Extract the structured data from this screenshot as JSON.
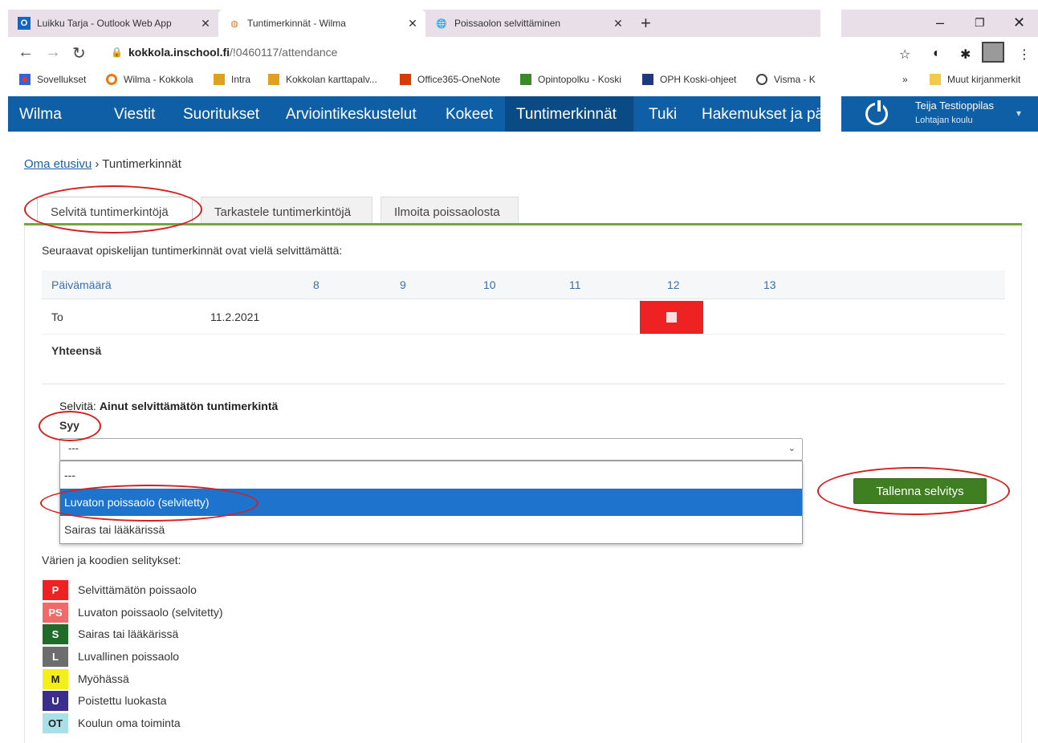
{
  "browser": {
    "tabs": [
      {
        "label": "Luikku Tarja - Outlook Web App",
        "icon": "O"
      },
      {
        "label": "Tuntimerkinnät - Wilma",
        "icon": "W"
      },
      {
        "label": "Poissaolon selvittäminen",
        "icon": "G"
      }
    ],
    "url_host": "kokkola.inschool.fi",
    "url_path": "/!0460117/attendance",
    "bookmarks": [
      "Sovellukset",
      "Wilma - Kokkola",
      "Intra",
      "Kokkolan karttapalv...",
      "Office365-OneNote",
      "Opintopolku - Koski",
      "OPH Koski-ohjeet",
      "Visma - K",
      "Muut kirjanmerkit"
    ]
  },
  "nav": {
    "logo": "Wilma",
    "items": [
      "Viestit",
      "Suoritukset",
      "Arviointikeskustelut",
      "Kokeet",
      "Tuntimerkinnät",
      "Tuki",
      "Hakemukset ja pä"
    ],
    "active_index": 4,
    "user_name": "Teija Testioppilas",
    "user_school": "Lohtajan koulu"
  },
  "breadcrumb": {
    "home": "Oma etusivu",
    "separator": "›",
    "current": "Tuntimerkinnät"
  },
  "tabs": [
    "Selvitä tuntimerkintöjä",
    "Tarkastele tuntimerkintöjä",
    "Ilmoita poissaolosta"
  ],
  "intro": "Seuraavat opiskelijan tuntimerkinnät ovat vielä selvittämättä:",
  "table": {
    "header": {
      "date_label": "Päivämäärä",
      "hours": [
        "8",
        "9",
        "10",
        "11",
        "12",
        "13"
      ]
    },
    "row": {
      "weekday": "To",
      "date": "11.2.2021"
    },
    "total_label": "Yhteensä"
  },
  "resolve": {
    "label": "Selvitä:",
    "text": "Ainut selvittämätön tuntimerkintä",
    "reason_label": "Syy",
    "select_value": "---",
    "options": [
      "---",
      "Luvaton poissaolo (selvitetty)",
      "Sairas tai lääkärissä"
    ],
    "selected_index": 1
  },
  "save_button": "Tallenna selvitys",
  "legend": {
    "title": "Värien ja koodien selitykset:",
    "items": [
      {
        "code": "P",
        "text": "Selvittämätön poissaolo",
        "color": "#ee2222"
      },
      {
        "code": "PS",
        "text": "Luvaton poissaolo (selvitetty)",
        "color": "#f06a6a"
      },
      {
        "code": "S",
        "text": "Sairas tai lääkärissä",
        "color": "#1e6b2a"
      },
      {
        "code": "L",
        "text": "Luvallinen poissaolo",
        "color": "#6d6d6d"
      },
      {
        "code": "M",
        "text": "Myöhässä",
        "color": "#f4ef1a"
      },
      {
        "code": "U",
        "text": "Poistettu luokasta",
        "color": "#3b2d8c"
      },
      {
        "code": "OT",
        "text": "Koulun oma toiminta",
        "color": "#a9dfe6"
      }
    ]
  }
}
